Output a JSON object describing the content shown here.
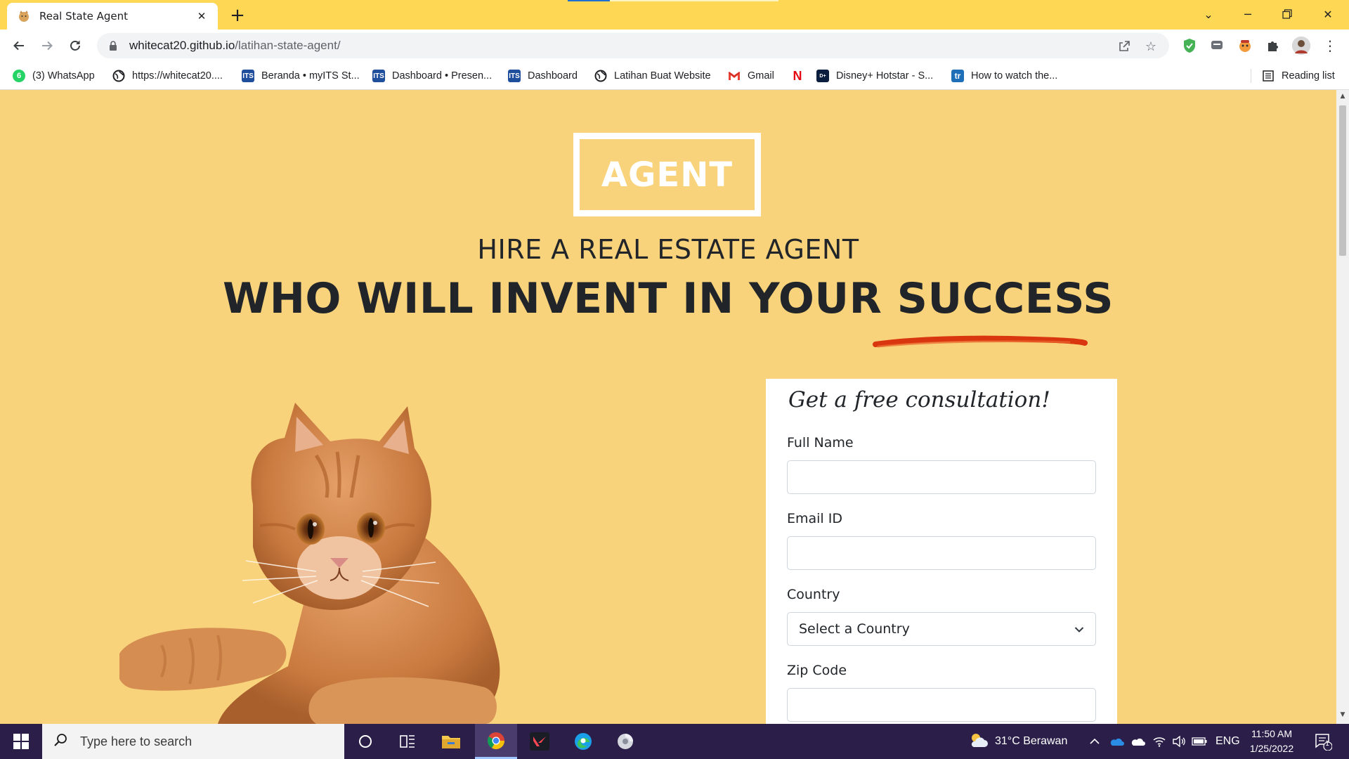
{
  "browser": {
    "tab_title": "Real State Agent",
    "url_host": "whitecat20.github.io",
    "url_path": "/latihan-state-agent/",
    "bookmarks": [
      {
        "label": "(3) WhatsApp",
        "icon": "whatsapp-icon",
        "color": "#25d366"
      },
      {
        "label": "https://whitecat20....",
        "icon": "globe-icon",
        "color": "#202124"
      },
      {
        "label": "Beranda • myITS St...",
        "icon": "its-icon",
        "color": "#1f4e9c"
      },
      {
        "label": "Dashboard • Presen...",
        "icon": "its-icon",
        "color": "#1f4e9c"
      },
      {
        "label": "Dashboard",
        "icon": "its-icon",
        "color": "#1f4e9c"
      },
      {
        "label": "Latihan Buat Website",
        "icon": "globe-icon",
        "color": "#202124"
      },
      {
        "label": "Gmail",
        "icon": "gmail-icon",
        "color": "#ea4335"
      },
      {
        "label": "",
        "icon": "netflix-icon",
        "color": "#e50914"
      },
      {
        "label": "Disney+ Hotstar - S...",
        "icon": "hotstar-icon",
        "color": "#0c1e3e"
      },
      {
        "label": "How to watch the...",
        "icon": "tr-icon",
        "color": "#1e6fb8"
      }
    ],
    "reading_list": "Reading list",
    "whatsapp_badge": "6"
  },
  "page": {
    "logo": "AGENT",
    "headline_1": "HIRE A REAL ESTATE AGENT",
    "headline_2": "WHO WILL INVENT IN YOUR SUCCESS",
    "accent_color": "#d9350f",
    "background_color": "#f8d37b",
    "form": {
      "title": "Get a free consultation!",
      "full_name_label": "Full Name",
      "full_name_value": "",
      "email_label": "Email ID",
      "email_value": "",
      "country_label": "Country",
      "country_value": "Select a Country",
      "zip_label": "Zip Code",
      "zip_value": ""
    }
  },
  "taskbar": {
    "search_placeholder": "Type here to search",
    "weather": "31°C  Berawan",
    "language": "ENG",
    "time": "11:50 AM",
    "date": "1/25/2022",
    "notification_count": "1"
  }
}
